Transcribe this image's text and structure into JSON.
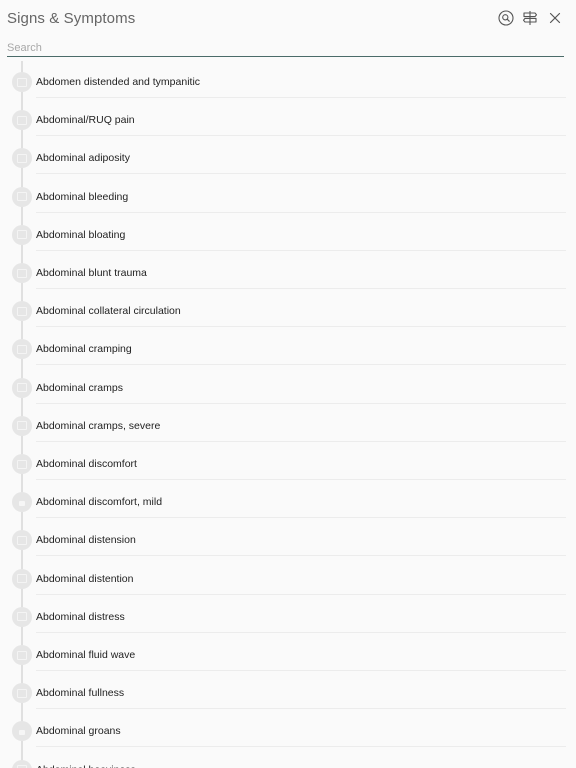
{
  "header": {
    "title": "Signs & Symptoms",
    "icons": [
      "search-circle-icon",
      "signpost-icon",
      "close-icon"
    ]
  },
  "search": {
    "placeholder": "Search",
    "value": ""
  },
  "list": {
    "items": [
      {
        "label": "Abdomen distended and tympanitic",
        "marker": "document-icon"
      },
      {
        "label": "Abdominal/RUQ pain",
        "marker": "image-icon"
      },
      {
        "label": "Abdominal adiposity",
        "marker": "document-icon"
      },
      {
        "label": "Abdominal bleeding",
        "marker": "document-icon"
      },
      {
        "label": "Abdominal bloating",
        "marker": "image-icon"
      },
      {
        "label": "Abdominal blunt trauma",
        "marker": "document-icon"
      },
      {
        "label": "Abdominal collateral circulation",
        "marker": "document-icon"
      },
      {
        "label": "Abdominal cramping",
        "marker": "image-icon"
      },
      {
        "label": "Abdominal cramps",
        "marker": "image-icon"
      },
      {
        "label": "Abdominal cramps, severe",
        "marker": "document-icon"
      },
      {
        "label": "Abdominal discomfort",
        "marker": "image-icon"
      },
      {
        "label": "Abdominal discomfort, mild",
        "marker": "lock-icon"
      },
      {
        "label": "Abdominal distension",
        "marker": "image-icon"
      },
      {
        "label": "Abdominal distention",
        "marker": "image-icon"
      },
      {
        "label": "Abdominal distress",
        "marker": "image-icon"
      },
      {
        "label": "Abdominal fluid wave",
        "marker": "document-icon"
      },
      {
        "label": "Abdominal fullness",
        "marker": "image-icon"
      },
      {
        "label": "Abdominal groans",
        "marker": "lock-icon"
      },
      {
        "label": "Abdominal heaviness",
        "marker": "document-icon"
      }
    ]
  },
  "colors": {
    "background": "#fafafa",
    "accent_underline": "#4b6b69",
    "marker": "#e6e6e6",
    "timeline": "#e0e0e0"
  }
}
